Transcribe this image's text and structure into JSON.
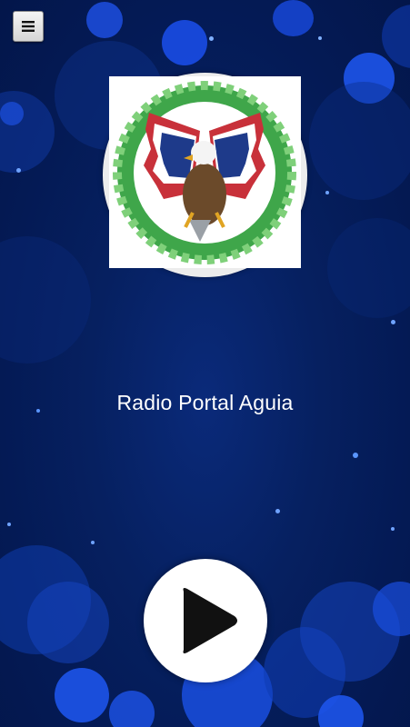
{
  "station": {
    "name": "Radio Portal Aguia"
  },
  "icons": {
    "menu": "hamburger-menu-icon",
    "play": "play-icon",
    "logo": "eagle-flag-logo"
  },
  "colors": {
    "background": "#062060",
    "play_button": "#ffffff",
    "play_icon": "#111111",
    "text": "#ffffff"
  }
}
